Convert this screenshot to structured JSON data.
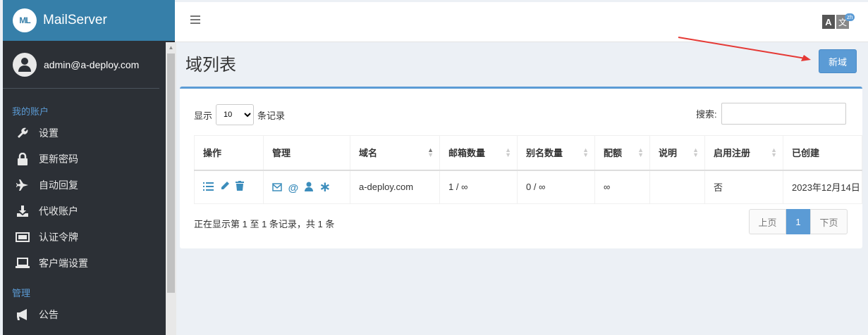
{
  "app": {
    "name": "MailServer"
  },
  "user": {
    "email": "admin@a-deploy.com"
  },
  "sidebar": {
    "section1": "我的账户",
    "items": [
      {
        "label": "设置",
        "icon": "wrench-icon"
      },
      {
        "label": "更新密码",
        "icon": "lock-icon"
      },
      {
        "label": "自动回复",
        "icon": "plane-icon"
      },
      {
        "label": "代收账户",
        "icon": "download-icon"
      },
      {
        "label": "认证令牌",
        "icon": "token-icon"
      },
      {
        "label": "客户端设置",
        "icon": "laptop-icon"
      }
    ],
    "section2": "管理",
    "items2": [
      {
        "label": "公告",
        "icon": "megaphone-icon"
      }
    ]
  },
  "topbar": {
    "lang_badge": "zh",
    "lang_a": "A",
    "lang_b": "文"
  },
  "page": {
    "title": "域列表",
    "new_button": "新域"
  },
  "table_controls": {
    "show_prefix": "显示",
    "page_length": "10",
    "show_suffix": "条记录",
    "search_label": "搜索:"
  },
  "table": {
    "headers": [
      "操作",
      "管理",
      "域名",
      "邮箱数量",
      "别名数量",
      "配额",
      "说明",
      "启用注册",
      "已创建"
    ],
    "rows": [
      {
        "domain": "a-deploy.com",
        "mailboxes": "1 / ∞",
        "aliases": "0 / ∞",
        "quota": "∞",
        "description": "",
        "registration": "否",
        "created": "2023年12月14日"
      }
    ]
  },
  "footer": {
    "info": "正在显示第 1 至 1 条记录，共 1 条",
    "prev": "上页",
    "current": "1",
    "next": "下页"
  },
  "colors": {
    "brand": "#367fa9",
    "sidebar": "#2c3036",
    "accent": "#5b9bd5"
  }
}
